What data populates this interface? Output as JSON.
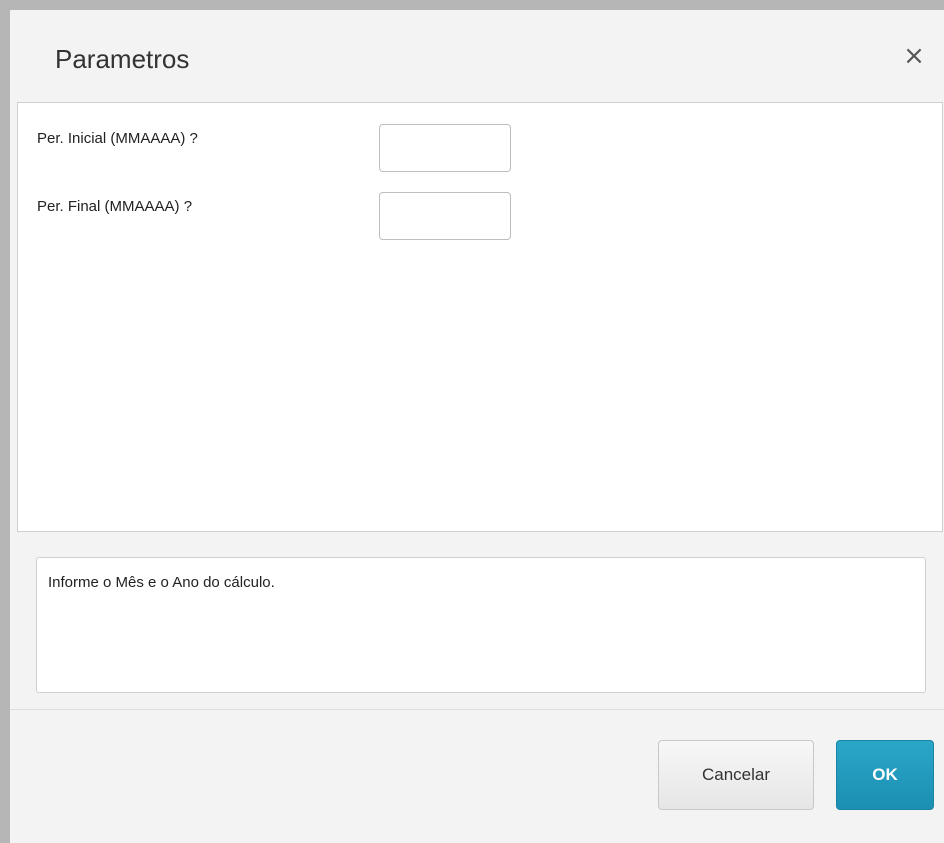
{
  "dialog": {
    "title": "Parametros",
    "close_symbol": "×"
  },
  "params": [
    {
      "label": "Per. Inicial (MMAAAA) ?",
      "value": ""
    },
    {
      "label": "Per. Final  (MMAAAA) ?",
      "value": ""
    }
  ],
  "help": {
    "text": "Informe o Mês e o Ano do cálculo."
  },
  "buttons": {
    "cancel_label": "Cancelar",
    "ok_label": "OK"
  },
  "colors": {
    "accent": "#2aa6c9",
    "background": "#f3f3f3"
  },
  "icons": {
    "close": "close-icon"
  }
}
